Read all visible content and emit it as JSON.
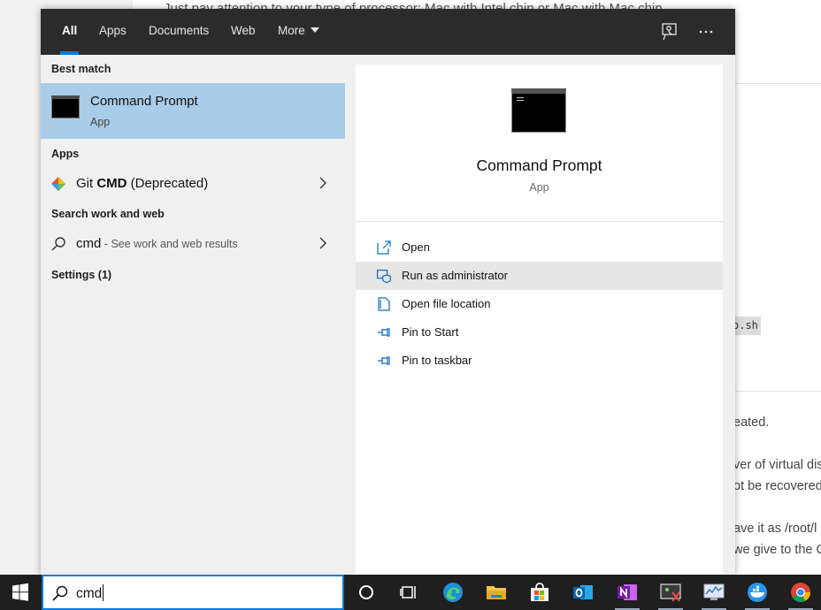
{
  "background": {
    "top_text": "Just pay attention to your type of processor: Mac with Intel chip or Mac with Mac chip",
    "code_fragment": "o.sh",
    "lines": [
      "eated.",
      "ver of virtual dis",
      "ot be recovered",
      "ave it as /root/l",
      "we give to the C"
    ]
  },
  "tabs": [
    {
      "label": "All",
      "active": true
    },
    {
      "label": "Apps"
    },
    {
      "label": "Documents"
    },
    {
      "label": "Web"
    },
    {
      "label": "More"
    }
  ],
  "toolbar_icons": {
    "feedback": "feedback-icon",
    "more": "ellipsis-icon"
  },
  "results": {
    "best_match_heading": "Best match",
    "best_match": {
      "title": "Command Prompt",
      "subtitle": "App"
    },
    "apps_heading": "Apps",
    "apps": [
      {
        "label_prefix": "Git ",
        "label_bold": "CMD",
        "label_suffix": " (Deprecated)"
      }
    ],
    "web_heading": "Search work and web",
    "web_item": {
      "query": "cmd",
      "hint": " - See work and web results"
    },
    "settings_heading": "Settings (1)"
  },
  "preview": {
    "title": "Command Prompt",
    "subtitle": "App",
    "actions": [
      {
        "label": "Open",
        "icon": "open-icon"
      },
      {
        "label": "Run as administrator",
        "icon": "shield-admin-icon",
        "highlighted": true
      },
      {
        "label": "Open file location",
        "icon": "file-location-icon"
      },
      {
        "label": "Pin to Start",
        "icon": "pin-icon"
      },
      {
        "label": "Pin to taskbar",
        "icon": "pin-icon"
      }
    ]
  },
  "taskbar": {
    "search_value": "cmd",
    "apps": [
      "cortana",
      "task-view",
      "edge",
      "file-explorer",
      "store",
      "outlook",
      "onenote",
      "snipping-tool",
      "resource-monitor",
      "docker",
      "chrome"
    ]
  },
  "colors": {
    "accent": "#0b78d7",
    "selected_result": "#a9cce8",
    "tab_bar": "#2b2b2b",
    "taskbar": "#1f1f1f"
  }
}
